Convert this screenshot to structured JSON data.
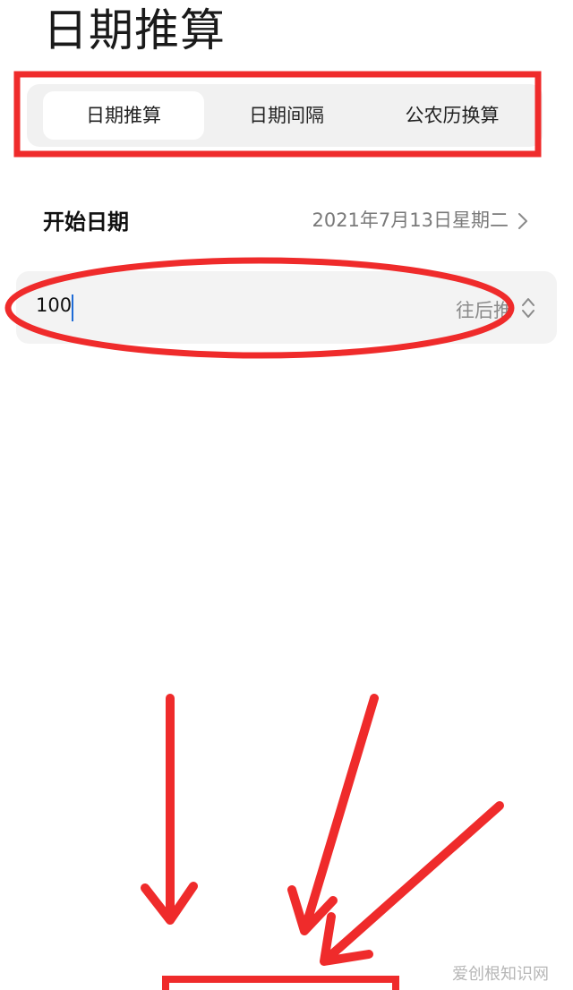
{
  "header": {
    "title": "日期推算"
  },
  "tabs": [
    {
      "label": "日期推算",
      "selected": true
    },
    {
      "label": "日期间隔",
      "selected": false
    },
    {
      "label": "公农历换算",
      "selected": false
    }
  ],
  "start_date": {
    "label": "开始日期",
    "value": "2021年7月13日星期二"
  },
  "days_input": {
    "value": "100",
    "direction": "往后推"
  },
  "annotations": {
    "color": "#ef2b2b"
  },
  "watermark": "爱创根知识网",
  "icons": [
    "chevron-right-icon",
    "up-down-icon"
  ]
}
